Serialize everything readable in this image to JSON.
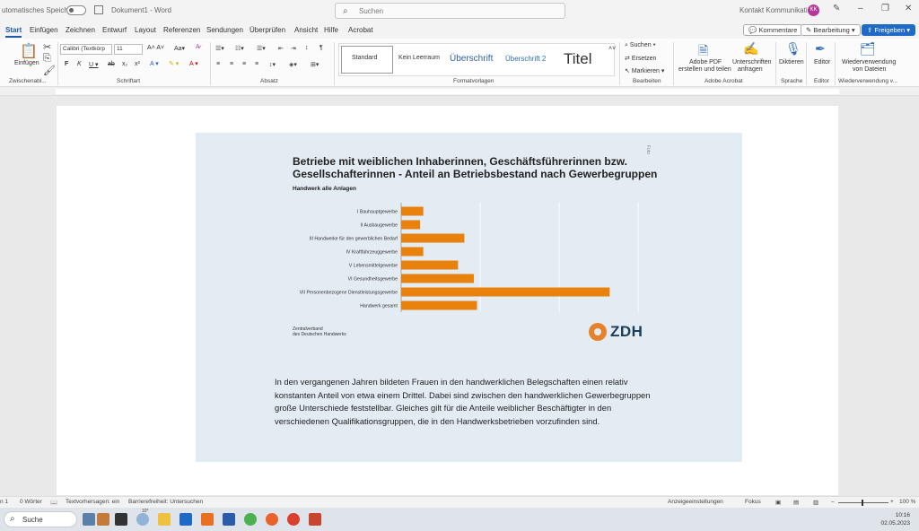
{
  "titlebar": {
    "autosave_label": "utomatisches Speichern",
    "doc_title": "Dokument1 - Word",
    "search_placeholder": "Suchen",
    "account": "Kontakt Kommunikation",
    "avatar_initials": "KK"
  },
  "tabs": [
    "Start",
    "Einfügen",
    "Zeichnen",
    "Entwurf",
    "Layout",
    "Referenzen",
    "Sendungen",
    "Überprüfen",
    "Ansicht",
    "Hilfe",
    "Acrobat"
  ],
  "top_buttons": {
    "comments": "Kommentare",
    "editing": "Bearbeitung",
    "share": "Freigeben"
  },
  "ribbon": {
    "clipboard": {
      "paste": "Einfügen",
      "label": "Zwischenabl..."
    },
    "font": {
      "name": "Calibri (Textkörp",
      "size": "11",
      "label": "Schriftart"
    },
    "paragraph": {
      "label": "Absatz"
    },
    "styles": {
      "items": [
        "Standard",
        "Kein Leerraum",
        "Überschrift",
        "Überschrift 2",
        "Titel"
      ],
      "label": "Formatvorlagen"
    },
    "editing": {
      "find": "Suchen",
      "replace": "Ersetzen",
      "select": "Markieren",
      "label": "Bearbeiten"
    },
    "acrobat": {
      "create_pdf_1": "Adobe PDF",
      "create_pdf_2": "erstellen und teilen",
      "sign_1": "Unterschriften",
      "sign_2": "anfragen",
      "label": "Adobe Acrobat"
    },
    "voice": {
      "dictate": "Diktieren",
      "label": "Sprache"
    },
    "editor": {
      "name": "Editor",
      "label": "Editor"
    },
    "reuse": {
      "line1": "Wiederverwendung",
      "line2": "von Dateien",
      "label": "Wiederverwendung v..."
    }
  },
  "figure": {
    "title_line1": "Betriebe mit weiblichen Inhaberinnen, Geschäftsführerinnen bzw.",
    "title_line2": "Gesellschafterinnen - Anteil an Betriebsbestand nach Gewerbegruppen",
    "subtitle": "Handwerk alle Anlagen",
    "foto_label": "Foto",
    "source_line1": "Zentralverband",
    "source_line2": "des Deutschen Handwerks",
    "logo_text": "ZDH"
  },
  "chart_data": {
    "type": "bar",
    "orientation": "horizontal",
    "title": "Betriebe mit weiblichen Inhaberinnen, Geschäftsführerinnen bzw. Gesellschafterinnen - Anteil an Betriebsbestand nach Gewerbegruppen",
    "subtitle": "Handwerk alle Anlagen",
    "categories": [
      "I Bauhauptgewerbe",
      "II Ausbaugewerbe",
      "III Handwerke für den gewerblichen Bedarf",
      "IV Kraftfahrzeuggewerbe",
      "V Lebensmittelgewerbe",
      "VI Gesundheitsgewerbe",
      "VII Personenbezogene Dienstleistungsgewerbe",
      "Handwerk gesamt"
    ],
    "values": [
      7,
      6,
      20,
      7,
      18,
      23,
      66,
      24
    ],
    "xlim": [
      0,
      75
    ],
    "ticks": [
      "0%",
      "25%",
      "50%",
      "75%"
    ],
    "tick_values": [
      0,
      25,
      50,
      75
    ],
    "grid": true,
    "color": "#e8820c"
  },
  "body_text": "In den vergangenen Jahren bildeten Frauen in den handwerklichen Belegschaften einen relativ konstanten Anteil von etwa einem Drittel. Dabei sind zwischen den handwerklichen Gewerbegruppen große Unterschiede feststellbar. Gleiches gilt für die Anteile weiblicher Beschäftigter in den verschiedenen Qualifikationsgruppen, die in den Handwerksbetrieben vorzufinden sind.",
  "statusbar": {
    "page": "n 1",
    "words": "0 Wörter",
    "predictions": "Textvorhersagen: ein",
    "accessibility": "Barrierefreiheit: Untersuchen",
    "display": "Anzeigeeinstellungen",
    "focus": "Fokus",
    "zoom": "100 %"
  },
  "taskbar": {
    "search": "Suche",
    "weather": "10°",
    "time": "10:16",
    "date": "02.05.2023"
  },
  "colors": {
    "accent": "#1e5aa8",
    "bar": "#e8820c",
    "figure_bg": "#e3ecf3",
    "logo_orange": "#e8822a",
    "logo_navy": "#1c3d5a"
  }
}
